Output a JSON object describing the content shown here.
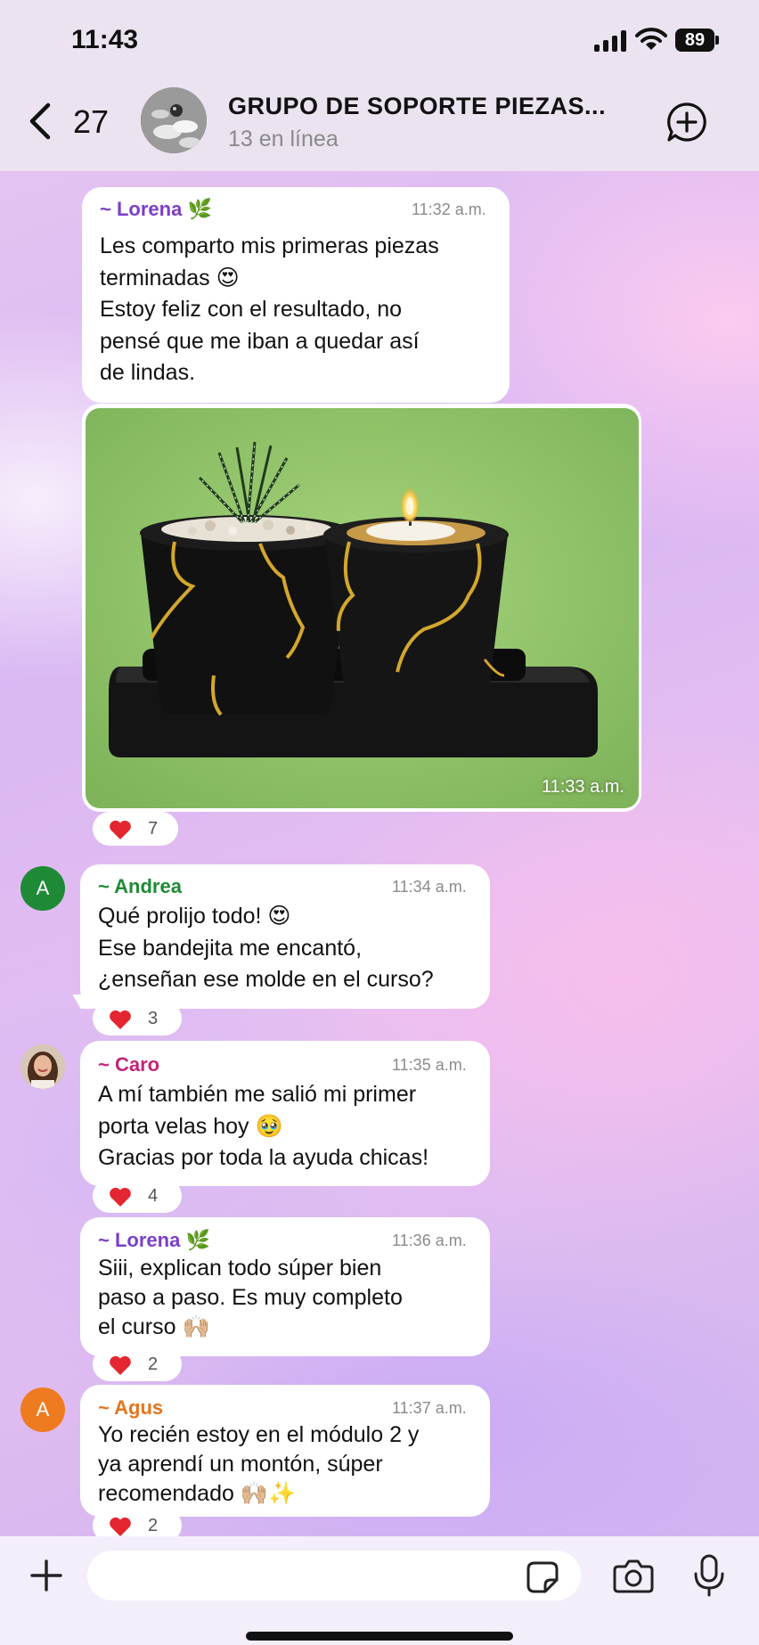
{
  "status_bar": {
    "time": "11:43",
    "battery": "89"
  },
  "header": {
    "back_count": "27",
    "title": "GRUPO DE SOPORTE PIEZAS...",
    "subtitle": "13 en línea"
  },
  "messages": [
    {
      "sender": "~ Lorena",
      "sender_emoji": "🌿",
      "time": "11:32 a.m.",
      "text": "Les comparto mis primeras piezas\nterminadas 😍\nEstoy feliz con el resultado, no\npensé que me iban a quedar así\nde lindas."
    },
    {
      "photo_time": "11:33 a.m.",
      "reaction_count": "7"
    },
    {
      "avatar_letter": "A",
      "sender": "~ Andrea",
      "time": "11:34 a.m.",
      "text": "Qué prolijo todo! 😍\nEse bandejita me encantó,\n¿enseñan ese molde en el curso?",
      "reaction_count": "3"
    },
    {
      "sender": "~ Caro",
      "time": "11:35 a.m.",
      "text": "A mí también me salió mi primer\nporta velas hoy 🥹\nGracias por toda la ayuda chicas!",
      "reaction_count": "4"
    },
    {
      "sender": "~ Lorena",
      "sender_emoji": "🌿",
      "time": "11:36 a.m.",
      "text": "Siii, explican todo súper bien\npaso a paso. Es muy completo\nel curso 🙌🏼",
      "reaction_count": "2"
    },
    {
      "avatar_letter": "A",
      "sender": "~ Agus",
      "time": "11:37 a.m.",
      "text": "Yo recién estoy en el módulo 2 y\nya aprendí un montón, súper\nrecomendado 🙌🏼✨",
      "reaction_count": "2"
    }
  ],
  "reaction_emoji": "❤️",
  "composer": {
    "placeholder": "",
    "value": ""
  },
  "colors": {
    "lorena": "#7b3fc7",
    "andrea": "#1e8a35",
    "caro": "#c2257a",
    "agus": "#e6741b",
    "heart": "#e3262f"
  }
}
